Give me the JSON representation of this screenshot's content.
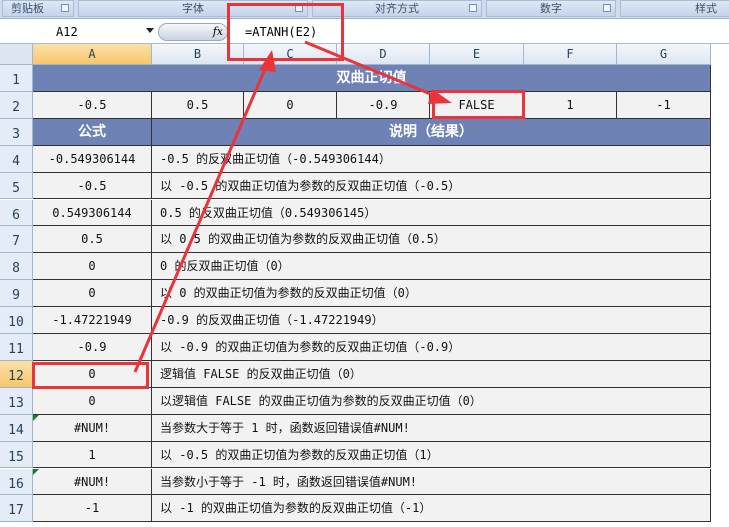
{
  "ribbon": {
    "groups": [
      "剪贴板",
      "字体",
      "对齐方式",
      "数字",
      "样式"
    ]
  },
  "formula_bar": {
    "name_box": "A12",
    "fx": "fx",
    "formula": "=ATANH(E2)"
  },
  "columns": [
    "A",
    "B",
    "C",
    "D",
    "E",
    "F",
    "G"
  ],
  "rows": [
    "1",
    "2",
    "3",
    "4",
    "5",
    "6",
    "7",
    "8",
    "9",
    "10",
    "11",
    "12",
    "13",
    "14",
    "15",
    "16",
    "17"
  ],
  "title": "双曲正切值",
  "inputs": [
    "-0.5",
    "0.5",
    "0",
    "-0.9",
    "FALSE",
    "1",
    "-1"
  ],
  "headers": {
    "formula": "公式",
    "desc": "说明（结果）"
  },
  "table": [
    {
      "r": "-0.549306144",
      "d": "-0.5 的反双曲正切值（-0.549306144）"
    },
    {
      "r": "-0.5",
      "d": "以 -0.5 的双曲正切值为参数的反双曲正切值（-0.5）"
    },
    {
      "r": "0.549306144",
      "d": "0.5 的反双曲正切值（0.549306145）"
    },
    {
      "r": "0.5",
      "d": "以 0.5 的双曲正切值为参数的反双曲正切值（0.5）"
    },
    {
      "r": "0",
      "d": "0 的反双曲正切值（0）"
    },
    {
      "r": "0",
      "d": "以 0 的双曲正切值为参数的反双曲正切值（0）"
    },
    {
      "r": "-1.47221949",
      "d": "-0.9 的反双曲正切值（-1.47221949）"
    },
    {
      "r": "-0.9",
      "d": "以 -0.9 的双曲正切值为参数的反双曲正切值（-0.9）"
    },
    {
      "r": "0",
      "d": "逻辑值 FALSE 的反双曲正切值（0）"
    },
    {
      "r": "0",
      "d": "以逻辑值 FALSE 的双曲正切值为参数的反双曲正切值（0）"
    },
    {
      "r": "#NUM!",
      "d": "当参数大于等于 1 时，函数返回错误值#NUM!"
    },
    {
      "r": "1",
      "d": "以 -0.5 的双曲正切值为参数的反双曲正切值（1）"
    },
    {
      "r": "#NUM!",
      "d": "当参数小于等于 -1 时，函数返回错误值#NUM!"
    },
    {
      "r": "-1",
      "d": "以 -1 的双曲正切值为参数的反双曲正切值（-1）"
    }
  ],
  "colors": {
    "header_fill": "#6e82b5",
    "annotation": "#e8343a"
  }
}
